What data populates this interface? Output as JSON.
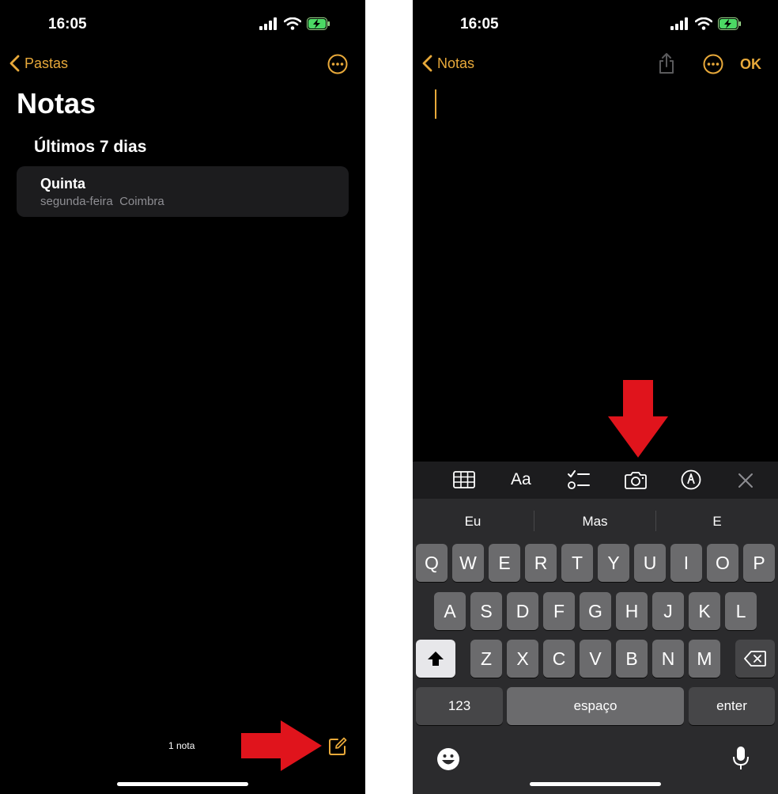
{
  "left": {
    "status": {
      "time": "16:05"
    },
    "nav": {
      "back_label": "Pastas"
    },
    "title": "Notas",
    "section": "Últimos 7 dias",
    "notes": [
      {
        "title": "Quinta",
        "day": "segunda-feira",
        "folder": "Coimbra"
      }
    ],
    "footer": {
      "count": "1 nota"
    }
  },
  "right": {
    "status": {
      "time": "16:05"
    },
    "nav": {
      "back_label": "Notas",
      "done_label": "OK"
    },
    "toolbar": {
      "format_label": "Aa"
    },
    "predictions": [
      "Eu",
      "Mas",
      "E"
    ],
    "keyboard": {
      "row1": [
        "Q",
        "W",
        "E",
        "R",
        "T",
        "Y",
        "U",
        "I",
        "O",
        "P"
      ],
      "row2": [
        "A",
        "S",
        "D",
        "F",
        "G",
        "H",
        "J",
        "K",
        "L"
      ],
      "row3": [
        "Z",
        "X",
        "C",
        "V",
        "B",
        "N",
        "M"
      ],
      "numbers_label": "123",
      "space_label": "espaço",
      "enter_label": "enter"
    }
  },
  "colors": {
    "accent": "#e8a93a",
    "arrow": "#e0141c",
    "card": "#1c1c1e",
    "keyboard": "#2b2b2d"
  }
}
